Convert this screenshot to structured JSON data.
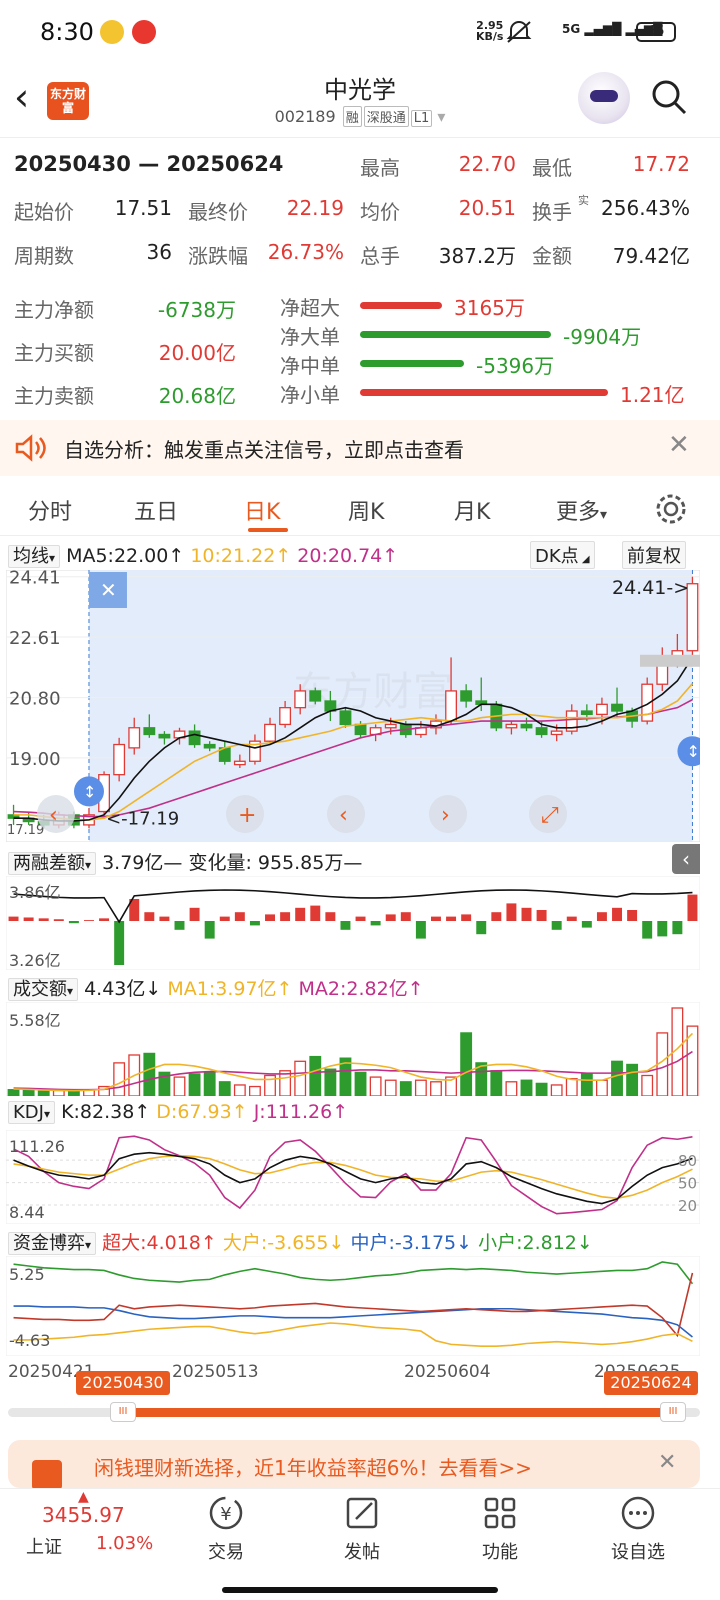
{
  "status": {
    "time": "8:30",
    "netspeed_value": "2.95",
    "netspeed_unit": "KB/s",
    "network": "5G",
    "battery": "66"
  },
  "header": {
    "logo": "东方财富",
    "name": "中光学",
    "code": "002189",
    "tags": [
      "融",
      "深股通",
      "L1"
    ]
  },
  "summary": {
    "range": "20250430 — 20250624",
    "stats": [
      {
        "label": "最高",
        "value": "22.70"
      },
      {
        "label": "最低",
        "value": "17.72"
      },
      {
        "label": "起始价",
        "value": "17.51"
      },
      {
        "label": "最终价",
        "value": "22.19"
      },
      {
        "label": "均价",
        "value": "20.51"
      },
      {
        "label": "换手",
        "sup": "实",
        "value": "256.43%"
      },
      {
        "label": "周期数",
        "value": "36"
      },
      {
        "label": "涨跌幅",
        "value": "26.73%"
      },
      {
        "label": "总手",
        "value": "387.2万"
      },
      {
        "label": "金额",
        "value": "79.42亿"
      }
    ]
  },
  "money_flow": {
    "left": [
      {
        "label": "主力净额",
        "value": "-6738万"
      },
      {
        "label": "主力买额",
        "value": "20.00亿"
      },
      {
        "label": "主力卖额",
        "value": "20.68亿"
      }
    ],
    "right": [
      {
        "label": "净超大",
        "value": "3165万",
        "frac": 0.33
      },
      {
        "label": "净大单",
        "value": "-9904万",
        "frac": 0.77
      },
      {
        "label": "净中单",
        "value": "-5396万",
        "frac": 0.42
      },
      {
        "label": "净小单",
        "value": "1.21亿",
        "frac": 1.0
      }
    ]
  },
  "banner": {
    "text": "自选分析：触发重点关注信号，立即点击查看"
  },
  "tabs": [
    "分时",
    "五日",
    "日K",
    "周K",
    "月K",
    "更多"
  ],
  "active_tab": "日K",
  "kline": {
    "indicator": "均线",
    "ma5": "MA5:22.00",
    "ma10": "10:21.22",
    "ma20": "20:20.74",
    "dk": "DK点",
    "adjust": "前复权",
    "yticks": [
      "24.41",
      "22.61",
      "20.80",
      "19.00",
      "17.19"
    ],
    "high_label": "24.41->",
    "low_label": "<-17.19",
    "watermark": "东方财富"
  },
  "margin": {
    "name": "两融差额",
    "value": "3.79亿—",
    "change": "变化量: 955.85万—",
    "yticks": [
      "3.86亿",
      "3.26亿"
    ]
  },
  "volume": {
    "name": "成交额",
    "value": "4.43亿",
    "ma1": "MA1:3.97亿",
    "ma2": "MA2:2.82亿",
    "ytick": "5.58亿"
  },
  "kdj": {
    "name": "KDJ",
    "k": "K:82.38",
    "d": "D:67.93",
    "j": "J:111.26",
    "yticks": [
      "111.26",
      "8.44"
    ],
    "rticks": [
      "80",
      "50",
      "20"
    ]
  },
  "fund": {
    "name": "资金博弈",
    "super": "超大:4.018",
    "large": "大户:-3.655",
    "mid": "中户:-3.175",
    "small": "小户:2.812",
    "yticks": [
      "5.25",
      "-4.63"
    ]
  },
  "dates": {
    "axis": [
      "20250421",
      "20250513",
      "20250604",
      "20250625"
    ],
    "range_start": "20250430",
    "range_end": "20250624"
  },
  "ad": {
    "text": "闲钱理财新选择，近1年收益率超6%！去看看>>"
  },
  "bottom": {
    "index_value": "3455.97",
    "index_name": "上证",
    "index_change": "1.03%",
    "items": [
      "交易",
      "发帖",
      "功能",
      "设自选"
    ]
  },
  "colors": {
    "up": "#e03a35",
    "down": "#2e9b2e",
    "accent": "#e85a1f",
    "ma5": "#111111",
    "ma10": "#f0b429",
    "ma20": "#c0308a"
  },
  "chart_data": [
    {
      "type": "candlestick",
      "note_series": "daily",
      "ohlc": [
        [
          17.3,
          17.6,
          17.0,
          17.2
        ],
        [
          17.2,
          17.4,
          17.0,
          17.1
        ],
        [
          17.1,
          17.3,
          16.9,
          17.0
        ],
        [
          17.0,
          17.4,
          16.9,
          17.3
        ],
        [
          17.3,
          17.4,
          16.9,
          17.0
        ],
        [
          17.0,
          17.5,
          16.9,
          17.3
        ],
        [
          17.4,
          18.6,
          17.3,
          18.5
        ],
        [
          18.5,
          19.6,
          18.3,
          19.4
        ],
        [
          19.3,
          20.2,
          19.1,
          19.9
        ],
        [
          19.9,
          20.3,
          19.6,
          19.7
        ],
        [
          19.7,
          19.8,
          19.4,
          19.6
        ],
        [
          19.6,
          19.9,
          19.4,
          19.8
        ],
        [
          19.8,
          20.0,
          19.3,
          19.4
        ],
        [
          19.4,
          19.5,
          19.2,
          19.3
        ],
        [
          19.3,
          19.5,
          18.8,
          18.9
        ],
        [
          18.8,
          19.1,
          18.7,
          18.9
        ],
        [
          18.9,
          19.7,
          18.8,
          19.5
        ],
        [
          19.5,
          20.2,
          19.4,
          20.0
        ],
        [
          20.0,
          20.7,
          19.9,
          20.5
        ],
        [
          20.5,
          21.2,
          20.3,
          21.0
        ],
        [
          21.0,
          21.1,
          20.6,
          20.7
        ],
        [
          20.7,
          21.0,
          20.1,
          20.4
        ],
        [
          20.4,
          20.5,
          19.9,
          20.0
        ],
        [
          20.0,
          20.1,
          19.6,
          19.7
        ],
        [
          19.7,
          20.0,
          19.5,
          19.9
        ],
        [
          19.9,
          20.2,
          19.7,
          20.0
        ],
        [
          20.0,
          20.1,
          19.6,
          19.7
        ],
        [
          19.7,
          20.1,
          19.6,
          19.9
        ],
        [
          19.9,
          20.3,
          19.7,
          20.1
        ],
        [
          20.1,
          22.0,
          20.0,
          21.0
        ],
        [
          21.0,
          21.2,
          20.5,
          20.7
        ],
        [
          20.7,
          21.4,
          20.4,
          20.6
        ],
        [
          20.6,
          20.7,
          19.8,
          19.9
        ],
        [
          19.9,
          20.1,
          19.7,
          20.0
        ],
        [
          20.0,
          20.2,
          19.8,
          19.9
        ],
        [
          19.9,
          20.1,
          19.6,
          19.7
        ],
        [
          19.7,
          20.0,
          19.5,
          19.8
        ],
        [
          19.8,
          20.6,
          19.7,
          20.4
        ],
        [
          20.4,
          20.6,
          20.1,
          20.3
        ],
        [
          20.3,
          20.8,
          20.0,
          20.6
        ],
        [
          20.6,
          21.1,
          20.2,
          20.4
        ],
        [
          20.4,
          20.5,
          19.9,
          20.1
        ],
        [
          20.1,
          21.4,
          20.0,
          21.2
        ],
        [
          21.2,
          22.3,
          21.0,
          22.0
        ],
        [
          22.0,
          22.7,
          21.7,
          22.2
        ],
        [
          22.2,
          24.41,
          22.0,
          24.2
        ]
      ],
      "ma5": [
        17.2,
        17.2,
        17.15,
        17.12,
        17.12,
        17.15,
        17.3,
        17.8,
        18.4,
        18.9,
        19.3,
        19.6,
        19.7,
        19.6,
        19.5,
        19.4,
        19.3,
        19.4,
        19.6,
        19.9,
        20.2,
        20.4,
        20.5,
        20.4,
        20.2,
        20.1,
        20.0,
        20.0,
        19.95,
        20.1,
        20.3,
        20.6,
        20.6,
        20.5,
        20.3,
        20.0,
        19.9,
        19.9,
        19.95,
        20.1,
        20.3,
        20.4,
        20.6,
        20.9,
        21.3,
        22.0
      ],
      "ma10": [
        17.3,
        17.3,
        17.25,
        17.2,
        17.15,
        17.15,
        17.2,
        17.4,
        17.7,
        18.0,
        18.3,
        18.6,
        18.9,
        19.1,
        19.3,
        19.4,
        19.4,
        19.45,
        19.5,
        19.6,
        19.7,
        19.8,
        19.95,
        20.0,
        20.05,
        20.1,
        20.15,
        20.2,
        20.15,
        20.1,
        20.1,
        20.2,
        20.25,
        20.3,
        20.3,
        20.25,
        20.2,
        20.2,
        20.2,
        20.2,
        20.2,
        20.25,
        20.3,
        20.45,
        20.7,
        21.22
      ],
      "ma20": [
        17.4,
        17.38,
        17.35,
        17.3,
        17.28,
        17.25,
        17.25,
        17.3,
        17.4,
        17.5,
        17.65,
        17.8,
        17.95,
        18.1,
        18.25,
        18.4,
        18.55,
        18.7,
        18.85,
        19.0,
        19.15,
        19.3,
        19.45,
        19.6,
        19.7,
        19.8,
        19.85,
        19.9,
        19.95,
        20.0,
        20.05,
        20.1,
        20.1,
        20.1,
        20.1,
        20.1,
        20.12,
        20.15,
        20.17,
        20.2,
        20.22,
        20.25,
        20.3,
        20.4,
        20.5,
        20.74
      ]
    },
    {
      "type": "bar",
      "name": "两融差额变化",
      "values": [
        0.1,
        0.08,
        0.06,
        0.04,
        -0.05,
        0.02,
        0.06,
        -1.0,
        0.5,
        0.2,
        0.1,
        -0.2,
        0.3,
        -0.4,
        0.1,
        0.2,
        -0.1,
        0.15,
        0.2,
        0.3,
        0.35,
        0.2,
        -0.2,
        0.1,
        -0.1,
        0.15,
        0.2,
        -0.4,
        0.1,
        0.1,
        0.15,
        -0.3,
        0.2,
        0.4,
        0.3,
        0.25,
        -0.2,
        0.1,
        -0.15,
        0.2,
        0.3,
        0.25,
        -0.4,
        -0.35,
        -0.3,
        0.6
      ]
    },
    {
      "type": "bar",
      "name": "成交额",
      "values": [
        0.4,
        0.35,
        0.3,
        0.35,
        0.3,
        0.4,
        0.6,
        2.1,
        2.6,
        2.7,
        1.5,
        1.2,
        1.4,
        1.5,
        0.9,
        0.7,
        0.6,
        1.3,
        1.6,
        2.2,
        2.5,
        1.7,
        2.4,
        1.5,
        1.2,
        1.0,
        0.9,
        1.0,
        0.9,
        1.2,
        4.0,
        2.1,
        1.6,
        0.9,
        1.0,
        0.8,
        0.7,
        1.1,
        1.4,
        1.0,
        2.2,
        2.0,
        1.3,
        4.0,
        5.58,
        4.43
      ],
      "ma1": [
        0.45,
        0.42,
        0.38,
        0.35,
        0.34,
        0.36,
        0.42,
        0.8,
        1.3,
        1.7,
        2.0,
        2.0,
        1.9,
        1.7,
        1.45,
        1.25,
        1.05,
        1.05,
        1.15,
        1.3,
        1.6,
        1.9,
        2.1,
        2.05,
        1.95,
        1.8,
        1.5,
        1.2,
        1.05,
        1.0,
        1.5,
        1.9,
        2.0,
        2.0,
        1.85,
        1.6,
        1.25,
        1.05,
        1.0,
        1.0,
        1.3,
        1.5,
        1.6,
        2.2,
        3.0,
        3.97
      ],
      "ma2": [
        0.5,
        0.48,
        0.45,
        0.42,
        0.4,
        0.4,
        0.42,
        0.55,
        0.8,
        1.05,
        1.25,
        1.4,
        1.5,
        1.55,
        1.55,
        1.5,
        1.45,
        1.4,
        1.4,
        1.45,
        1.5,
        1.55,
        1.6,
        1.65,
        1.65,
        1.6,
        1.6,
        1.55,
        1.5,
        1.45,
        1.5,
        1.55,
        1.6,
        1.62,
        1.62,
        1.6,
        1.55,
        1.5,
        1.45,
        1.45,
        1.45,
        1.5,
        1.55,
        1.8,
        2.2,
        2.82
      ]
    },
    {
      "type": "line",
      "name": "KDJ",
      "K": [
        80,
        72,
        65,
        60,
        58,
        55,
        60,
        82,
        88,
        90,
        88,
        85,
        82,
        75,
        60,
        50,
        55,
        70,
        80,
        85,
        82,
        75,
        65,
        55,
        50,
        55,
        58,
        50,
        48,
        55,
        75,
        78,
        70,
        58,
        50,
        42,
        35,
        30,
        25,
        22,
        28,
        45,
        60,
        70,
        75,
        82.38
      ],
      "D": [
        75,
        72,
        68,
        64,
        62,
        60,
        60,
        68,
        76,
        82,
        85,
        86,
        85,
        82,
        75,
        67,
        62,
        63,
        68,
        74,
        77,
        77,
        73,
        67,
        60,
        57,
        56,
        55,
        52,
        52,
        58,
        64,
        66,
        64,
        59,
        54,
        48,
        42,
        36,
        31,
        29,
        33,
        40,
        50,
        58,
        67.93
      ],
      "J": [
        95,
        85,
        65,
        50,
        45,
        42,
        55,
        110,
        112,
        107,
        94,
        86,
        76,
        60,
        30,
        16,
        40,
        85,
        104,
        107,
        92,
        71,
        49,
        31,
        30,
        51,
        62,
        40,
        40,
        62,
        110,
        107,
        78,
        46,
        32,
        18,
        8.44,
        10,
        12,
        14,
        26,
        70,
        100,
        110,
        108,
        111.26
      ]
    },
    {
      "type": "line",
      "name": "资金博弈",
      "super": [
        -1.0,
        -1.1,
        -1.2,
        -1.2,
        -1.3,
        -1.3,
        -1.2,
        0.4,
        0.0,
        0.2,
        0.3,
        0.4,
        0.3,
        0.2,
        0.1,
        0.0,
        0.1,
        0.3,
        0.4,
        0.5,
        0.6,
        0.4,
        0.2,
        0.1,
        0.0,
        -0.1,
        -0.2,
        -0.3,
        -0.2,
        -0.1,
        0.0,
        -0.1,
        -0.2,
        -0.3,
        -0.3,
        -0.2,
        -0.1,
        0.0,
        0.1,
        0.2,
        0.3,
        0.4,
        0.3,
        -1.0,
        -3.0,
        4.018
      ],
      "large": [
        -3.5,
        -3.5,
        -3.4,
        -3.3,
        -3.2,
        -3.0,
        -2.9,
        -2.7,
        -2.5,
        -2.3,
        -2.2,
        -2.1,
        -2.0,
        -2.0,
        -2.3,
        -2.6,
        -2.8,
        -2.6,
        -2.3,
        -2.0,
        -1.8,
        -1.6,
        -1.7,
        -1.9,
        -2.1,
        -2.2,
        -2.3,
        -2.5,
        -3.6,
        -4.0,
        -4.1,
        -4.2,
        -4.2,
        -4.1,
        -3.9,
        -3.8,
        -3.7,
        -3.8,
        -3.9,
        -4.0,
        -3.9,
        -3.7,
        -3.4,
        -3.0,
        -2.8,
        -3.655
      ],
      "mid": [
        0.3,
        0.3,
        0.2,
        0.2,
        0.2,
        0.1,
        0.1,
        -0.2,
        -0.6,
        -0.9,
        -1.0,
        -1.1,
        -1.1,
        -1.0,
        -0.9,
        -0.8,
        -0.8,
        -0.9,
        -1.0,
        -1.0,
        -1.0,
        -1.0,
        -0.9,
        -0.8,
        -0.7,
        -0.6,
        -0.5,
        -0.4,
        -0.3,
        -0.2,
        -0.1,
        0.0,
        0.0,
        0.0,
        -0.1,
        -0.2,
        -0.3,
        -0.4,
        -0.5,
        -0.6,
        -0.8,
        -1.0,
        -1.1,
        -1.3,
        -1.8,
        -3.175
      ],
      "small": [
        5.0,
        4.8,
        4.6,
        4.5,
        4.4,
        4.4,
        4.3,
        3.8,
        3.4,
        3.2,
        3.1,
        3.0,
        3.2,
        3.3,
        3.8,
        4.2,
        4.5,
        4.2,
        3.9,
        3.5,
        3.3,
        3.2,
        3.3,
        3.5,
        3.7,
        3.8,
        4.0,
        4.3,
        4.4,
        4.5,
        4.4,
        4.5,
        4.4,
        4.3,
        4.1,
        4.0,
        3.9,
        4.0,
        4.1,
        4.2,
        4.3,
        4.3,
        4.5,
        5.25,
        5.0,
        2.812
      ]
    }
  ]
}
